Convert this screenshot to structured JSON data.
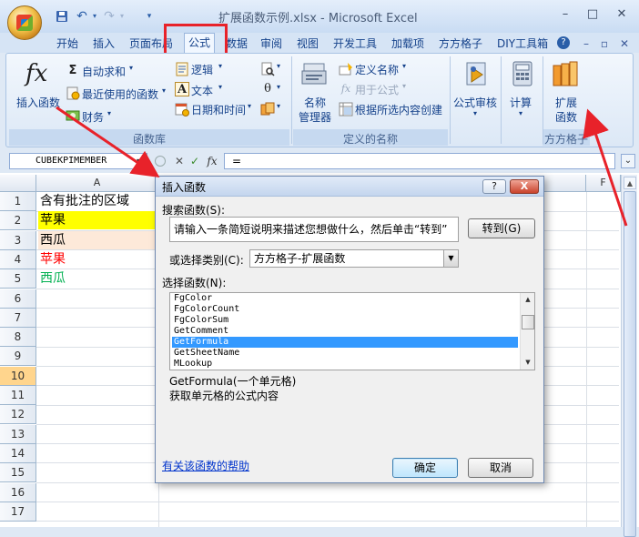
{
  "window": {
    "title": "扩展函数示例.xlsx - Microsoft Excel",
    "qat_icons": [
      "save-icon",
      "undo-icon",
      "redo-icon",
      "customize-qat-icon"
    ],
    "controls": [
      "minimize-icon",
      "maximize-icon",
      "close-icon"
    ]
  },
  "tabs": [
    {
      "label": "开始"
    },
    {
      "label": "插入"
    },
    {
      "label": "页面布局"
    },
    {
      "label": "公式",
      "active": true
    },
    {
      "label": "数据"
    },
    {
      "label": "审阅"
    },
    {
      "label": "视图"
    },
    {
      "label": "开发工具"
    },
    {
      "label": "加载项"
    },
    {
      "label": "方方格子"
    },
    {
      "label": "DIY工具箱"
    }
  ],
  "ribbon": {
    "function_library": {
      "label": "函数库",
      "insert_function": "插入函数",
      "autosum": "自动求和",
      "recently_used": "最近使用的函数",
      "financial": "财务",
      "logical": "逻辑",
      "text": "文本",
      "datetime": "日期和时间"
    },
    "defined_names": {
      "label": "定义的名称",
      "name_manager_line1": "名称",
      "name_manager_line2": "管理器",
      "define_name": "定义名称",
      "use_in_formula": "用于公式",
      "create_from_selection": "根据所选内容创建"
    },
    "formula_audit": "公式审核",
    "calculation": "计算",
    "ffgz": {
      "label": "方方格子",
      "extend_line1": "扩展",
      "extend_line2": "函数"
    }
  },
  "formula_bar": {
    "name_box": "CUBEKPIMEMBER",
    "content": "="
  },
  "sheet": {
    "columns": [
      "A",
      "F"
    ],
    "rows": [
      "1",
      "2",
      "3",
      "4",
      "5",
      "6",
      "7",
      "8",
      "9",
      "10",
      "11",
      "12",
      "13",
      "14",
      "15",
      "16",
      "17"
    ],
    "selected_row": "10",
    "cells": [
      {
        "row": 1,
        "text": "含有批注的区域",
        "color": "#000000",
        "bg": "#ffffff"
      },
      {
        "row": 2,
        "text": "苹果",
        "color": "#000000",
        "bg": "#ffff00"
      },
      {
        "row": 3,
        "text": "西瓜",
        "color": "#000000",
        "bg": "#fde9d9"
      },
      {
        "row": 4,
        "text": "苹果",
        "color": "#ff0000",
        "bg": "#ffffff"
      },
      {
        "row": 5,
        "text": "西瓜",
        "color": "#00b050",
        "bg": "#ffffff"
      }
    ]
  },
  "dialog": {
    "title": "插入函数",
    "help_btn": "?",
    "close_btn": "X",
    "search_label": "搜索函数(S):",
    "search_value": "请输入一条简短说明来描述您想做什么，然后单击“转到”",
    "goto_btn": "转到(G)",
    "category_label": "或选择类别(C):",
    "category_value": "方方格子-扩展函数",
    "select_label": "选择函数(N):",
    "functions": [
      "FgColor",
      "FgColorCount",
      "FgColorSum",
      "GetComment",
      "GetFormula",
      "GetSheetName",
      "MLookup"
    ],
    "selected_function": "GetFormula",
    "signature": "GetFormula(一个单元格)",
    "description": "获取单元格的公式内容",
    "help_link": "有关该函数的帮助",
    "ok_btn": "确定",
    "cancel_btn": "取消"
  },
  "colors": {
    "annotation_red": "#e8222a",
    "selection_blue": "#3399ff"
  }
}
